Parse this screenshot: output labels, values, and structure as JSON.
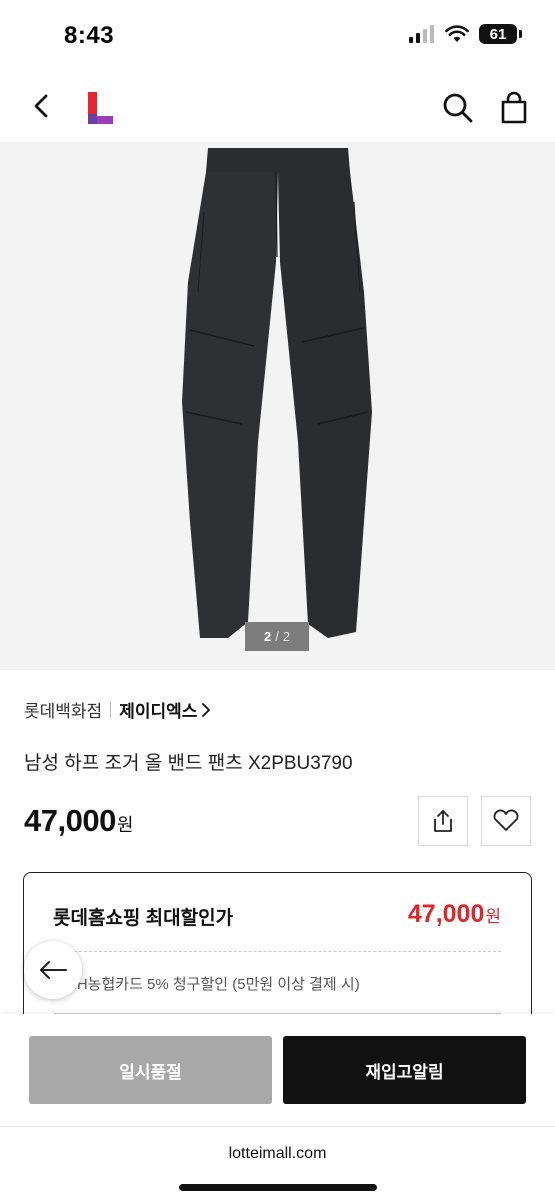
{
  "status": {
    "time": "8:43",
    "battery": "61"
  },
  "nav": {
    "icons": [
      "back-icon",
      "lotte-logo",
      "search-icon",
      "shopping-bag-icon"
    ]
  },
  "gallery": {
    "current": "2",
    "separator": "/",
    "total": "2"
  },
  "product": {
    "store": "롯데백화점",
    "brand": "제이디엑스",
    "name": "남성 하프 조거 올 밴드 팬츠 X2PBU3790",
    "price": "47,000",
    "price_unit": "원"
  },
  "discount": {
    "title": "롯데홈쇼핑 최대할인가",
    "price": "47,000",
    "price_unit": "원",
    "card_note": "NH농협카드 5% 청구할인 (5만원 이상 결제 시)"
  },
  "actions": {
    "soldout_label": "일시품절",
    "restock_label": "재입고알림"
  },
  "browser": {
    "url": "lotteimall.com"
  },
  "colors": {
    "accent_red": "#e0252b",
    "logo_red": "#e8262f",
    "logo_purple": "#6b3fa0",
    "button_dark": "#111111",
    "button_disabled": "#a8a8a8"
  }
}
